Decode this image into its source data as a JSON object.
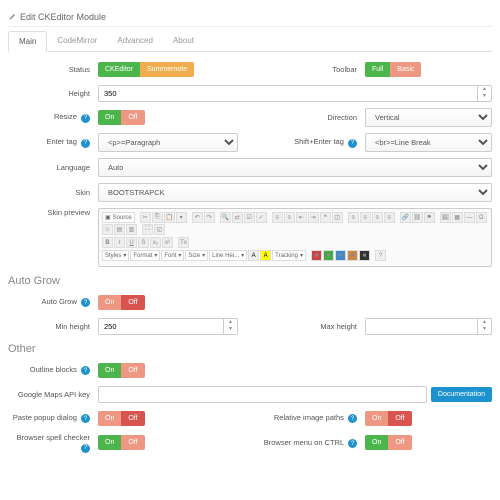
{
  "header": {
    "title": "Edit CKEditor Module"
  },
  "tabs": [
    {
      "label": "Main",
      "active": true
    },
    {
      "label": "CodeMirror"
    },
    {
      "label": "Advanced"
    },
    {
      "label": "About"
    }
  ],
  "status": {
    "label": "Status",
    "on": "CKEditor",
    "off": "Summernote"
  },
  "toolbar": {
    "label": "Toolbar",
    "full": "Full",
    "basic": "Basic"
  },
  "height": {
    "label": "Height",
    "value": "350"
  },
  "resize": {
    "label": "Resize",
    "on": "On",
    "off": "Off"
  },
  "direction": {
    "label": "Direction",
    "value": "Vertical"
  },
  "entertag": {
    "label": "Enter tag",
    "value": "<p>=Paragraph"
  },
  "shiftenter": {
    "label": "Shift+Enter tag",
    "value": "<br>=Line Break"
  },
  "language": {
    "label": "Language",
    "value": "Auto"
  },
  "skin": {
    "label": "Skin",
    "value": "BOOTSTRAPCK"
  },
  "skinpreview": {
    "label": "Skin preview",
    "source": "Source"
  },
  "dropdowns": {
    "styles": "Styles",
    "format": "Format",
    "font": "Font",
    "size": "Size",
    "lineheight": "Line Hei...",
    "tracking": "Tracking"
  },
  "sections": {
    "autogrow": "Auto Grow",
    "other": "Other"
  },
  "autogrow": {
    "label": "Auto Grow",
    "on": "On",
    "off": "Off"
  },
  "minheight": {
    "label": "Min height",
    "value": "250"
  },
  "maxheight": {
    "label": "Max height",
    "value": ""
  },
  "outline": {
    "label": "Outline blocks",
    "on": "On",
    "off": "Off"
  },
  "gmaps": {
    "label": "Google Maps API key",
    "doc": "Documentation"
  },
  "paste": {
    "label": "Paste popup dialog",
    "on": "On",
    "off": "Off"
  },
  "relimg": {
    "label": "Relative image paths",
    "on": "On",
    "off": "Off"
  },
  "spell": {
    "label": "Browser spell checker",
    "on": "On",
    "off": "Off"
  },
  "ctrlmenu": {
    "label": "Browser menu on CTRL",
    "on": "On",
    "off": "Off"
  }
}
